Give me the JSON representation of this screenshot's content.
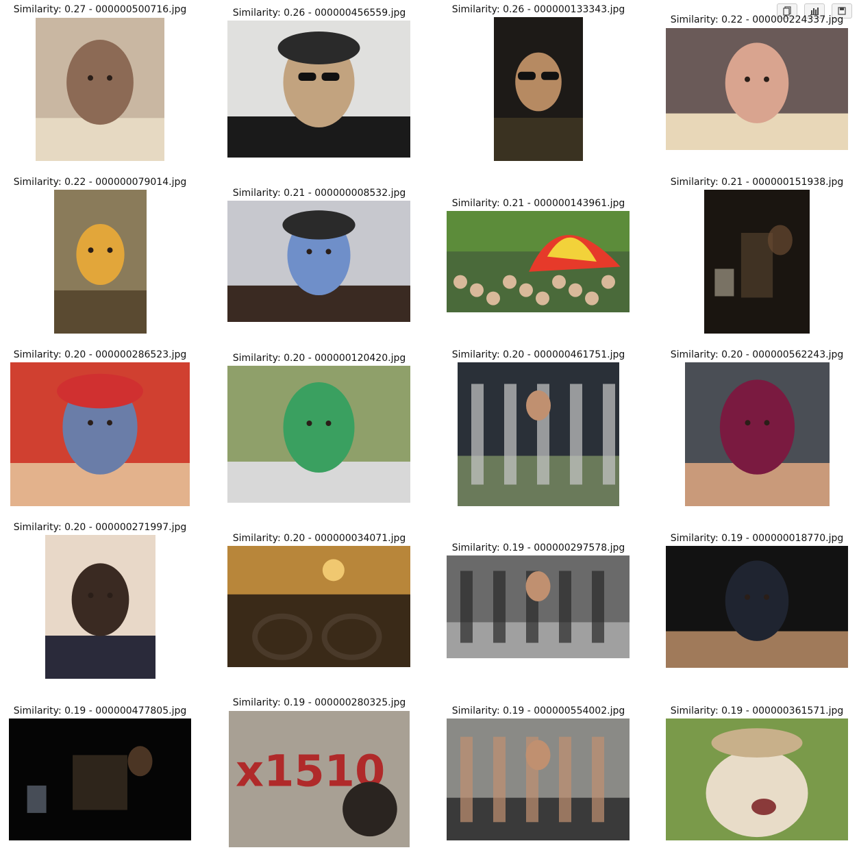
{
  "toolbar": {
    "buttons": [
      {
        "icon": "copy-icon",
        "label": "Copy"
      },
      {
        "icon": "chart-icon",
        "label": "Chart"
      },
      {
        "icon": "save-icon",
        "label": "Save"
      }
    ]
  },
  "results": [
    {
      "similarity": "0.27",
      "filename": "000000500716.jpg",
      "caption": "Similarity: 0.27 - 000000500716.jpg",
      "scene": "face-closeup",
      "colors": [
        "#c9b7a2",
        "#8c6a55",
        "#e6d9c2"
      ]
    },
    {
      "similarity": "0.26",
      "filename": "000000456559.jpg",
      "caption": "Similarity: 0.26 - 000000456559.jpg",
      "scene": "man-hat-sunglasses",
      "colors": [
        "#e0e0de",
        "#c2a37f",
        "#1a1a1a"
      ]
    },
    {
      "similarity": "0.26",
      "filename": "000000133343.jpg",
      "caption": "Similarity: 0.26 - 000000133343.jpg",
      "scene": "man-sunglasses-dark",
      "colors": [
        "#1d1a17",
        "#b68a62",
        "#3a3221"
      ]
    },
    {
      "similarity": "0.22",
      "filename": "000000224337.jpg",
      "caption": "Similarity: 0.22 - 000000224337.jpg",
      "scene": "man-eating",
      "colors": [
        "#6a5a58",
        "#d9a48f",
        "#e8d7b8"
      ]
    },
    {
      "similarity": "0.22",
      "filename": "000000079014.jpg",
      "caption": "Similarity: 0.22 - 000000079014.jpg",
      "scene": "reflection-orange",
      "colors": [
        "#8a7b5a",
        "#e2a63a",
        "#5a4a31"
      ]
    },
    {
      "similarity": "0.21",
      "filename": "000000008532.jpg",
      "caption": "Similarity: 0.21 - 000000008532.jpg",
      "scene": "man-cap-shirt",
      "colors": [
        "#c7c8ce",
        "#6f8fc9",
        "#3a2a22"
      ]
    },
    {
      "similarity": "0.21",
      "filename": "000000143961.jpg",
      "caption": "Similarity: 0.21 - 000000143961.jpg",
      "scene": "crowd-umbrella",
      "colors": [
        "#5c8c3a",
        "#e63a2a",
        "#f2d23a"
      ]
    },
    {
      "similarity": "0.21",
      "filename": "000000151938.jpg",
      "caption": "Similarity: 0.21 - 000000151938.jpg",
      "scene": "dark-table",
      "colors": [
        "#1a1510",
        "#5a4630",
        "#d8d0b8"
      ]
    },
    {
      "similarity": "0.20",
      "filename": "000000286523.jpg",
      "caption": "Similarity: 0.20 - 000000286523.jpg",
      "scene": "man-red-cap-phone",
      "colors": [
        "#d04030",
        "#6a7da8",
        "#e3b28c"
      ]
    },
    {
      "similarity": "0.20",
      "filename": "000000120420.jpg",
      "caption": "Similarity: 0.20 - 000000120420.jpg",
      "scene": "camera-park",
      "colors": [
        "#8fa06a",
        "#3aa060",
        "#d8d8d8"
      ]
    },
    {
      "similarity": "0.20",
      "filename": "000000461751.jpg",
      "caption": "Similarity: 0.20 - 000000461751.jpg",
      "scene": "motorbike-street",
      "colors": [
        "#2a3038",
        "#6a7a5a",
        "#c8c8c8"
      ]
    },
    {
      "similarity": "0.20",
      "filename": "000000562243.jpg",
      "caption": "Similarity: 0.20 - 000000562243.jpg",
      "scene": "man-maroon-shirt",
      "colors": [
        "#4a4e55",
        "#7a1a40",
        "#c99a7a"
      ]
    },
    {
      "similarity": "0.20",
      "filename": "000000271997.jpg",
      "caption": "Similarity: 0.20 - 000000271997.jpg",
      "scene": "portrait-boy",
      "colors": [
        "#e8d8c8",
        "#3a2a22",
        "#2a2a3a"
      ]
    },
    {
      "similarity": "0.20",
      "filename": "000000034071.jpg",
      "caption": "Similarity: 0.20 - 000000034071.jpg",
      "scene": "sunset-meters",
      "colors": [
        "#3a2a18",
        "#b8863a",
        "#1a120a"
      ]
    },
    {
      "similarity": "0.19",
      "filename": "000000297578.jpg",
      "caption": "Similarity: 0.19 - 000000297578.jpg",
      "scene": "man-street-smoking",
      "colors": [
        "#6a6a6a",
        "#a0a0a0",
        "#2a2a2a"
      ]
    },
    {
      "similarity": "0.19",
      "filename": "000000018770.jpg",
      "caption": "Similarity: 0.19 - 000000018770.jpg",
      "scene": "man-suit-dark",
      "colors": [
        "#121212",
        "#1f2430",
        "#a07a5a"
      ]
    },
    {
      "similarity": "0.19",
      "filename": "000000477805.jpg",
      "caption": "Similarity: 0.19 - 000000477805.jpg",
      "scene": "dark-laptop",
      "colors": [
        "#050505",
        "#4a3a2a",
        "#8a96aa"
      ]
    },
    {
      "similarity": "0.19",
      "filename": "000000280325.jpg",
      "caption": "Similarity: 0.19 - 000000280325.jpg",
      "scene": "graffiti-meter",
      "colors": [
        "#a8a094",
        "#b02a2a",
        "#2a2420"
      ]
    },
    {
      "similarity": "0.19",
      "filename": "000000554002.jpg",
      "caption": "Similarity: 0.19 - 000000554002.jpg",
      "scene": "legs-dog",
      "colors": [
        "#8a8a86",
        "#3a3a3a",
        "#c09070"
      ]
    },
    {
      "similarity": "0.19",
      "filename": "000000361571.jpg",
      "caption": "Similarity: 0.19 - 000000361571.jpg",
      "scene": "dog-cap",
      "colors": [
        "#7a9a4a",
        "#e8dcc8",
        "#c8b08a"
      ]
    }
  ]
}
